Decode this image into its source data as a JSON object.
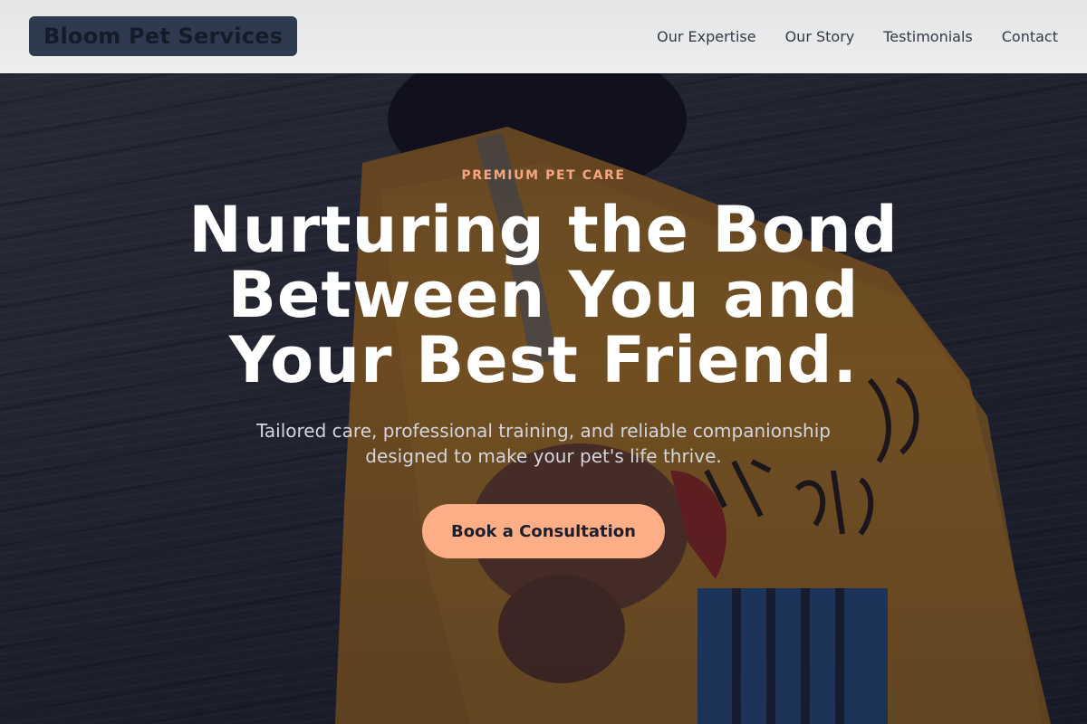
{
  "header": {
    "brand": "Bloom Pet Services",
    "nav": [
      "Our Expertise",
      "Our Story",
      "Testimonials",
      "Contact"
    ]
  },
  "hero": {
    "eyebrow": "PREMIUM PET CARE",
    "headline": [
      "Nurturing the Bond",
      "Between You and",
      "Your Best Friend."
    ],
    "subtext": [
      "Tailored care, professional training, and reliable companionship",
      "designed to make your pet's life thrive."
    ],
    "cta_label": "Book a Consultation"
  },
  "colors": {
    "accent": "#fdae86",
    "eyebrow": "#f5a680",
    "header_bg": "#eeeeef",
    "brand_bg": "#2d3a4f"
  }
}
